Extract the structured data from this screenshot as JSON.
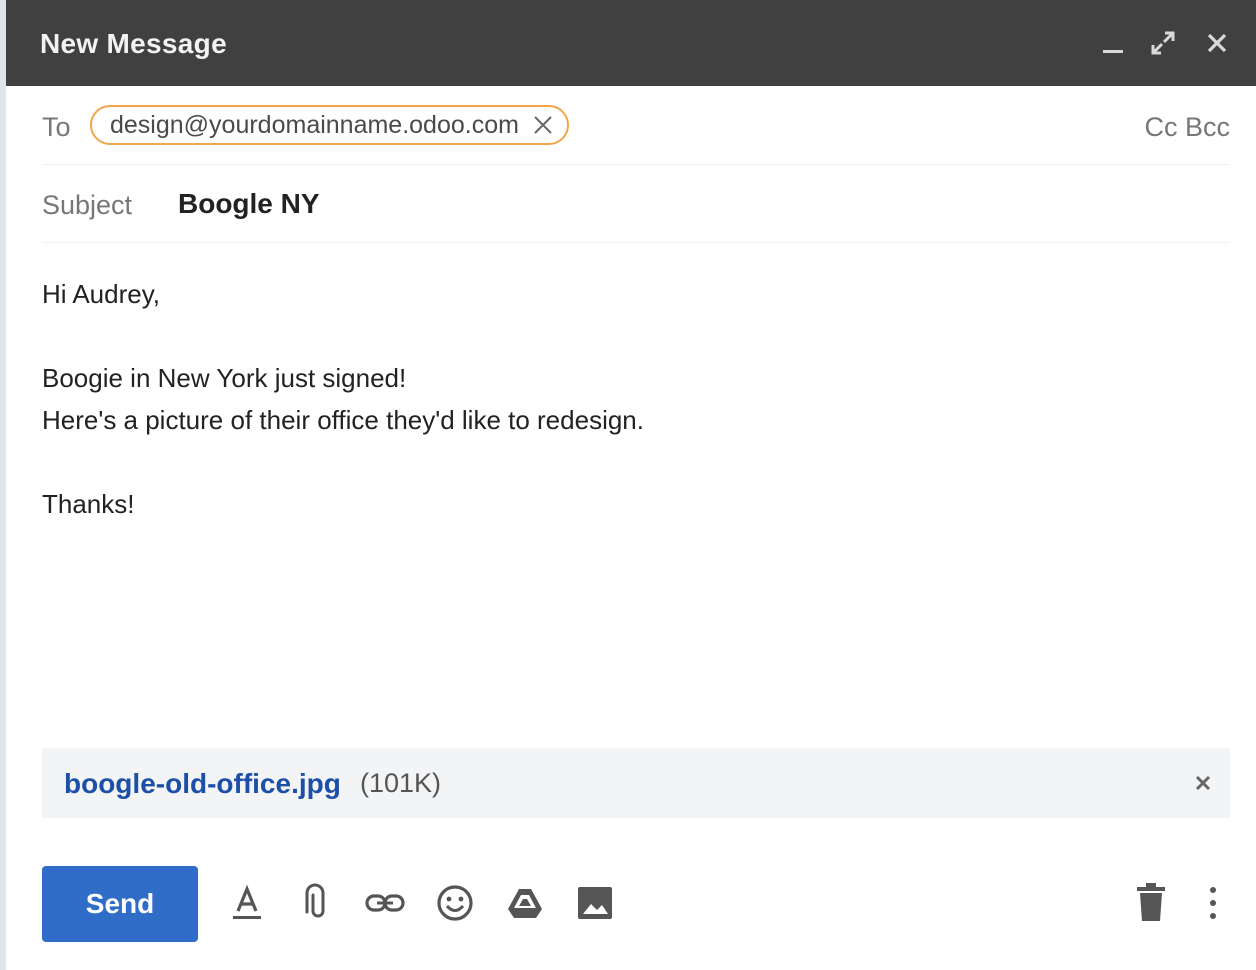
{
  "window": {
    "title": "New Message"
  },
  "recipients": {
    "to_label": "To",
    "chip_email": "design@yourdomainname.odoo.com",
    "cc_bcc": "Cc Bcc"
  },
  "subject": {
    "label": "Subject",
    "value": "Boogle NY"
  },
  "body": {
    "lines": [
      "Hi Audrey,",
      "Boogie in New York just signed!",
      "Here's a picture of their office they'd like to redesign.",
      "Thanks!"
    ]
  },
  "attachment": {
    "name": "boogle-old-office.jpg",
    "size": "(101K)"
  },
  "toolbar": {
    "send_label": "Send",
    "icons": [
      "format-text-icon",
      "attach-icon",
      "link-icon",
      "emoji-icon",
      "drive-icon",
      "image-icon",
      "trash-icon",
      "more-vert-icon"
    ]
  },
  "colors": {
    "titlebar": "#404040",
    "chip_border": "#f2a54a",
    "send_button": "#2f6dc9",
    "attachment_link": "#1d4fa8"
  }
}
